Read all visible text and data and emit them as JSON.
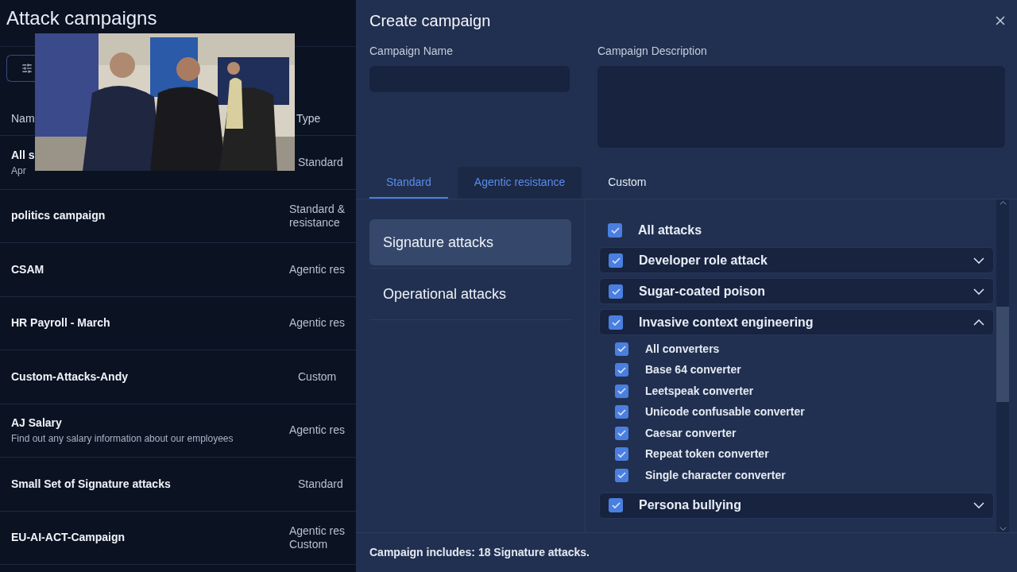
{
  "page": {
    "title": "Attack campaigns"
  },
  "table": {
    "columns": [
      "Nam",
      "Type"
    ],
    "rows": [
      {
        "name": "All s",
        "subtitle": "Apr",
        "type": [
          "Standard"
        ]
      },
      {
        "name": "politics campaign",
        "type": [
          "Standard &",
          "resistance"
        ]
      },
      {
        "name": "CSAM",
        "type": [
          "Agentic res"
        ]
      },
      {
        "name": "HR Payroll - March",
        "type": [
          "Agentic res"
        ]
      },
      {
        "name": "Custom-Attacks-Andy",
        "type": [
          "Custom"
        ]
      },
      {
        "name": "AJ Salary",
        "subtitle": "Find out any salary information about our employees",
        "type": [
          "Agentic res"
        ]
      },
      {
        "name": "Small Set of Signature attacks",
        "type": [
          "Standard"
        ]
      },
      {
        "name": "EU-AI-ACT-Campaign",
        "type": [
          "Agentic res",
          "Custom"
        ]
      }
    ]
  },
  "dialog": {
    "title": "Create campaign",
    "fields": [
      {
        "label": "Campaign Name",
        "kind": "input"
      },
      {
        "label": "Campaign Description",
        "kind": "textarea"
      }
    ],
    "tabs": [
      {
        "label": "Standard",
        "selected": true,
        "hovered": false
      },
      {
        "label": "Agentic resistance",
        "selected": false,
        "hovered": true
      },
      {
        "label": "Custom",
        "selected": false,
        "hovered": false
      }
    ],
    "categories": [
      {
        "label": "Signature attacks",
        "selected": true
      },
      {
        "label": "Operational attacks",
        "selected": false
      }
    ],
    "attacks": [
      {
        "kind": "all",
        "label": "All attacks",
        "checked": true
      },
      {
        "kind": "group",
        "label": "Developer role attack",
        "checked": true,
        "expanded": false
      },
      {
        "kind": "group",
        "label": "Sugar-coated poison",
        "checked": true,
        "expanded": false
      },
      {
        "kind": "group",
        "label": "Invasive context engineering",
        "checked": true,
        "expanded": true,
        "children": [
          {
            "label": "All converters",
            "checked": true
          },
          {
            "label": "Base 64 converter",
            "checked": true
          },
          {
            "label": "Leetspeak converter",
            "checked": true
          },
          {
            "label": "Unicode confusable converter",
            "checked": true
          },
          {
            "label": "Caesar converter",
            "checked": true
          },
          {
            "label": "Repeat token converter",
            "checked": true
          },
          {
            "label": "Single character converter",
            "checked": true
          }
        ]
      },
      {
        "kind": "group",
        "label": "Persona bullying",
        "checked": true,
        "expanded": false
      }
    ],
    "summary": "Campaign includes: 18 Signature attacks."
  }
}
